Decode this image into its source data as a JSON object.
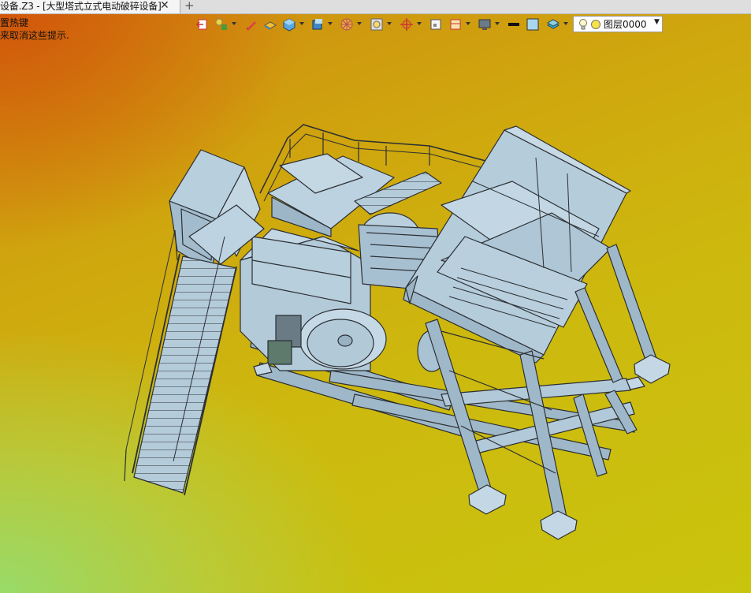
{
  "window": {
    "tab_title": "设备.Z3 - [大型塔式立式电动破碎设备]",
    "close_glyph": "✕",
    "new_tab_glyph": "+"
  },
  "hints": [
    "置热键",
    "来取消这些提示."
  ],
  "toolbar": {
    "icons": [
      "exit-icon",
      "light-icon",
      "pen-icon",
      "shade-mode-icon",
      "cube-render-icon",
      "view-cube-icon",
      "wheel-icon",
      "zoom-fit-icon",
      "orbit-icon",
      "frame-icon",
      "section-icon",
      "display-icon",
      "line-color-icon",
      "face-color-icon",
      "layer-stack-icon"
    ]
  },
  "layer_selector": {
    "value": "图层0000",
    "bulb_icon": "lightbulb-icon",
    "color_icon": "layer-color-dot-icon"
  },
  "colors": {
    "steel": "#a9c3d4",
    "steel_dark": "#7e98aa",
    "edge": "#2b2f33",
    "bg_orange": "#cf5a10",
    "bg_yellow": "#c9c40d",
    "bg_green": "#a6dc7c"
  }
}
